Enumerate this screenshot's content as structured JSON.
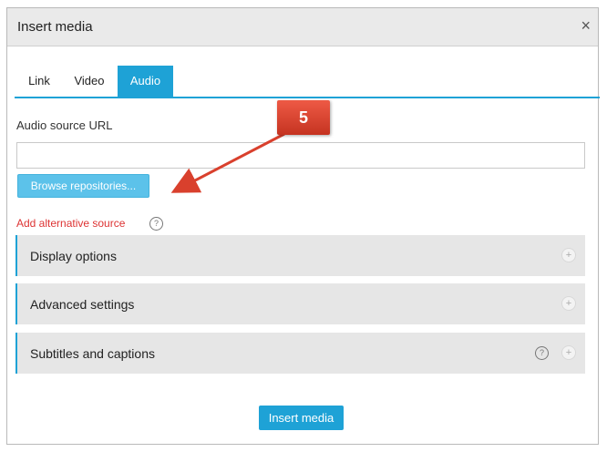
{
  "dialog": {
    "title": "Insert media",
    "close_glyph": "×",
    "tabs": [
      {
        "label": "Link"
      },
      {
        "label": "Video"
      },
      {
        "label": "Audio",
        "active": true
      }
    ],
    "audio_source_label": "Audio source URL",
    "audio_source_value": "",
    "browse_label": "Browse repositories...",
    "add_alternative_label": "Add alternative source",
    "help_glyph": "?",
    "sections": [
      {
        "label": "Display options",
        "expand_glyph": "+"
      },
      {
        "label": "Advanced settings",
        "expand_glyph": "+"
      },
      {
        "label": "Subtitles and captions",
        "expand_glyph": "+",
        "has_help": true
      }
    ],
    "insert_label": "Insert media"
  },
  "annotation": {
    "step_number": "5",
    "color": "#d9402d"
  },
  "colors": {
    "accent": "#1ea2d6",
    "browse_button": "#5cc2ea",
    "link_red": "#dd3333",
    "section_bg": "#e6e6e6"
  },
  "icons": [
    "close-icon",
    "help-icon",
    "plus-icon",
    "arrow-icon"
  ]
}
